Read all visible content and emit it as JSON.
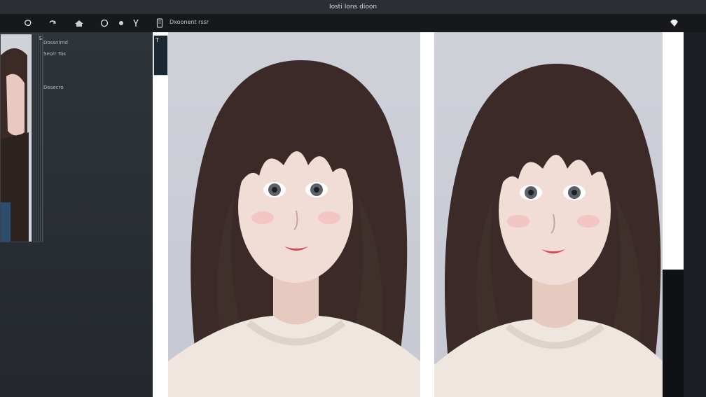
{
  "window": {
    "title": "Iosti Ions dioon"
  },
  "toolbar": {
    "icons": [
      "lasso-icon",
      "undo-icon",
      "home-icon",
      "circle-icon",
      "bullet-icon",
      "brush-icon",
      "tablet-icon",
      "gem-icon"
    ],
    "document_label": "Dxoonent rssr"
  },
  "panel": {
    "thumb_label": "S",
    "lines": [
      "Dossnirnd",
      "Seorr Tas",
      "Desecro"
    ]
  },
  "canvas": {
    "tile_label": "T",
    "left_image": "portrait-original",
    "right_image": "portrait-edited"
  }
}
